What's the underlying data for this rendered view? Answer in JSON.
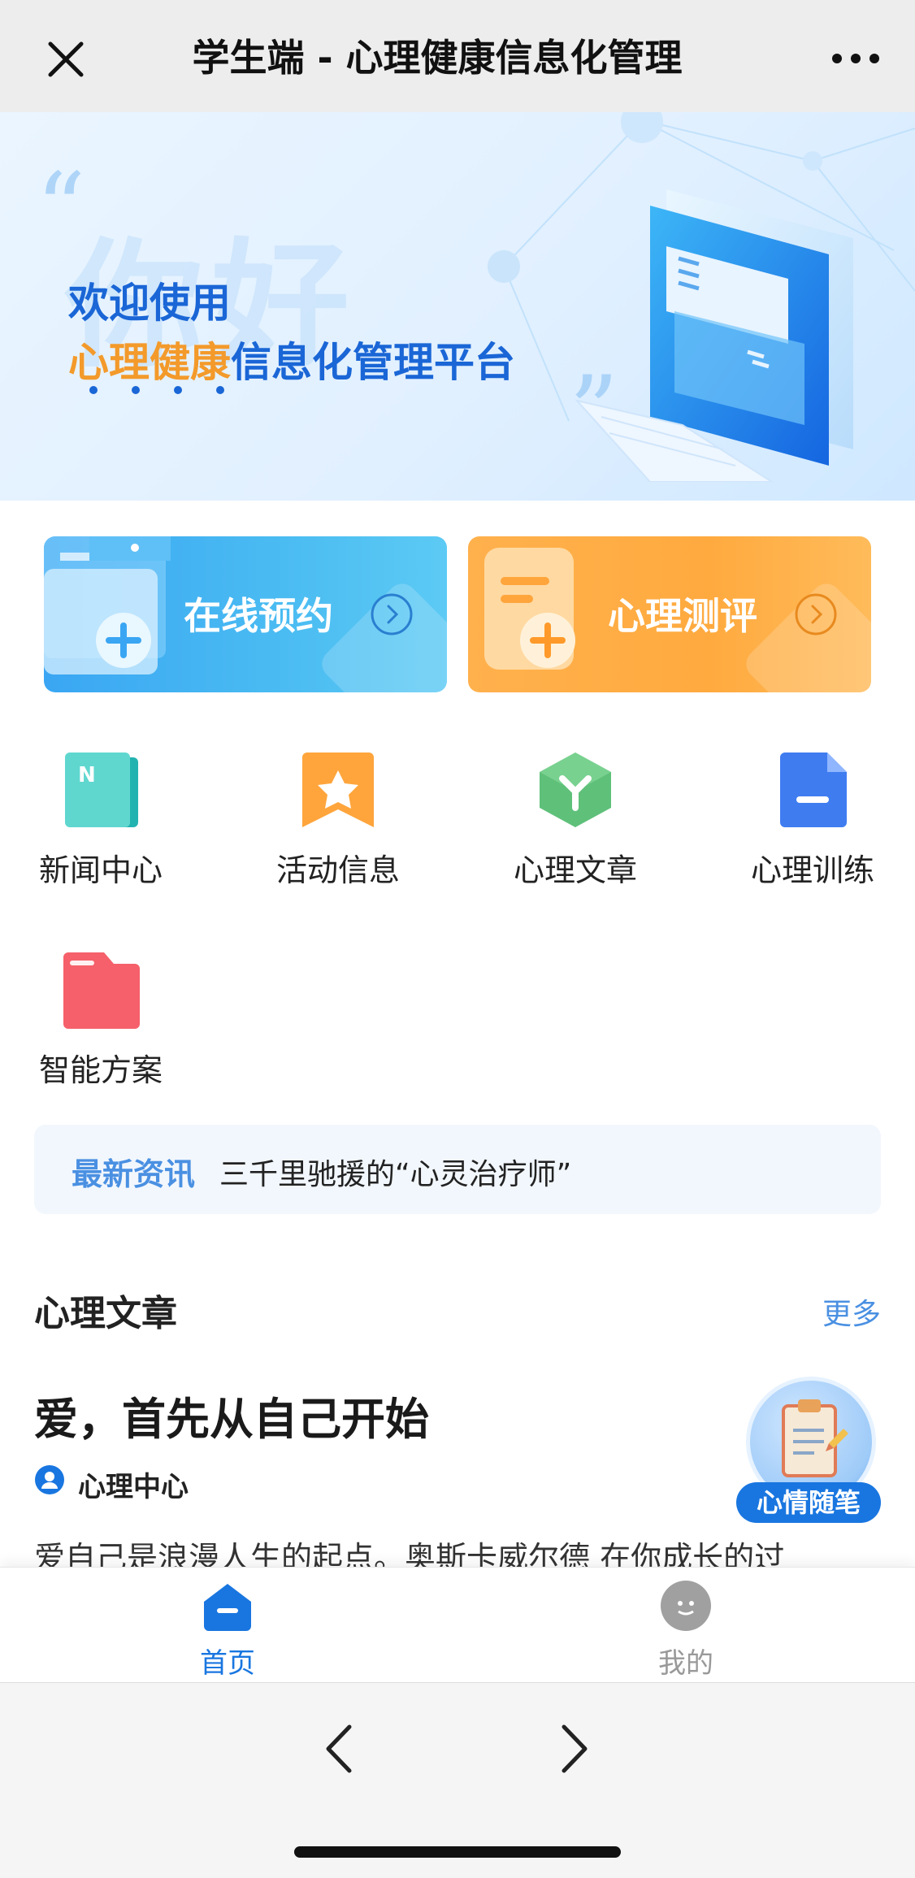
{
  "topbar": {
    "title": "学生端 - 心理健康信息化管理",
    "close_icon": "close-icon",
    "more_icon": "more-dots-icon"
  },
  "banner": {
    "ghost_text": "你好",
    "line1": "欢迎使用",
    "line2_highlight": "心理健康",
    "line2_rest": "信息化管理平台"
  },
  "big_cards": [
    {
      "label": "在线预约",
      "icon": "online-booking-icon",
      "color": "#3aa6f3"
    },
    {
      "label": "心理测评",
      "icon": "psych-assessment-icon",
      "color": "#ffaa3f"
    }
  ],
  "grid": [
    {
      "label": "新闻中心",
      "icon": "news-icon",
      "color": "#4fd1c5"
    },
    {
      "label": "活动信息",
      "icon": "activity-star-icon",
      "color": "#ffa53c"
    },
    {
      "label": "心理文章",
      "icon": "article-hexagon-icon",
      "color": "#5fc07a"
    },
    {
      "label": "心理训练",
      "icon": "training-doc-icon",
      "color": "#3f7cf0"
    },
    {
      "label": "智能方案",
      "icon": "smart-plan-folder-icon",
      "color": "#f5606a"
    }
  ],
  "ticker": {
    "tag": "最新资讯",
    "text": "三千里驰援的“心灵治疗师”"
  },
  "section": {
    "title": "心理文章",
    "more": "更多"
  },
  "article": {
    "title": "爱，首先从自己开始",
    "author": "心理中心",
    "excerpt": "爱自己是浪漫人生的起点。奥斯卡威尔德 在你成长的过"
  },
  "mood_button": {
    "label": "心情随笔"
  },
  "tabbar": {
    "tabs": [
      {
        "label": "首页",
        "active": true,
        "icon": "home-icon"
      },
      {
        "label": "我的",
        "active": false,
        "icon": "profile-icon"
      }
    ]
  },
  "browser": {
    "back_icon": "chevron-left-icon",
    "forward_icon": "chevron-right-icon"
  },
  "colors": {
    "accent": "#1976e0",
    "link": "#4a90e2",
    "orange": "#f39a2b"
  }
}
